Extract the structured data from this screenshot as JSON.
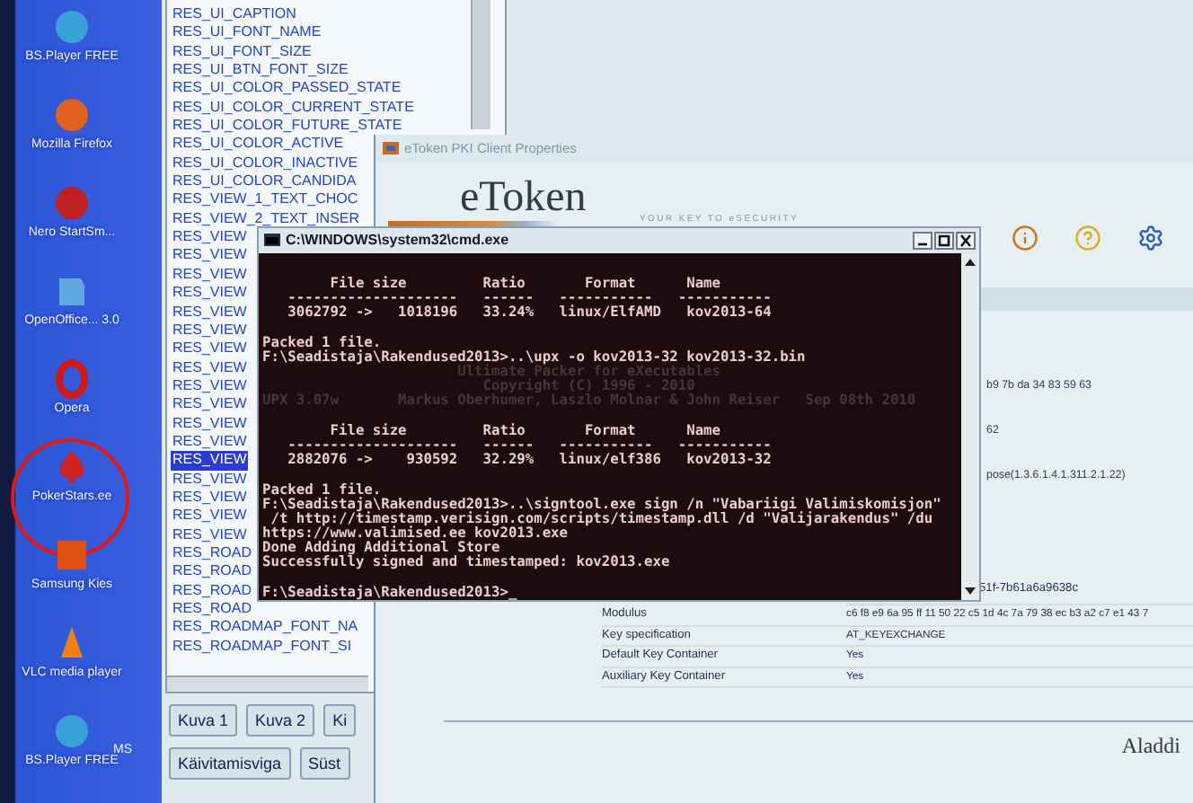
{
  "desktop_icons": [
    {
      "label": "BS.Player FREE",
      "kind": "player",
      "circled": false
    },
    {
      "label": "Mozilla Firefox",
      "kind": "firefox",
      "circled": false
    },
    {
      "label": "Nero StartSm...",
      "kind": "nero",
      "circled": false
    },
    {
      "label": "OpenOffice... 3.0",
      "kind": "office",
      "circled": false
    },
    {
      "label": "Opera",
      "kind": "opera",
      "circled": false
    },
    {
      "label": "PokerStars.ee",
      "kind": "poker",
      "circled": true
    },
    {
      "label": "Samsung Kies",
      "kind": "kies",
      "circled": false
    },
    {
      "label": "VLC media player",
      "kind": "vlc",
      "circled": false
    },
    {
      "label": "BS.Player FREE",
      "kind": "player",
      "circled": false
    }
  ],
  "desktop_partial_label": "MS",
  "resource_list": {
    "items": [
      {
        "text": "RES_UI_CAPTION",
        "selected": false
      },
      {
        "text": "RES_UI_FONT_NAME",
        "selected": false
      },
      {
        "text": "RES_UI_FONT_SIZE",
        "selected": false
      },
      {
        "text": "RES_UI_BTN_FONT_SIZE",
        "selected": false
      },
      {
        "text": "RES_UI_COLOR_PASSED_STATE",
        "selected": false
      },
      {
        "text": "RES_UI_COLOR_CURRENT_STATE",
        "selected": false
      },
      {
        "text": "RES_UI_COLOR_FUTURE_STATE",
        "selected": false
      },
      {
        "text": "RES_UI_COLOR_ACTIVE",
        "selected": false
      },
      {
        "text": "RES_UI_COLOR_INACTIVE",
        "selected": false
      },
      {
        "text": "RES_UI_COLOR_CANDIDA",
        "selected": false
      },
      {
        "text": "RES_VIEW_1_TEXT_CHOC",
        "selected": false
      },
      {
        "text": "RES_VIEW_2_TEXT_INSER",
        "selected": false
      },
      {
        "text": "RES_VIEW",
        "selected": false
      },
      {
        "text": "RES_VIEW",
        "selected": false
      },
      {
        "text": "RES_VIEW",
        "selected": false
      },
      {
        "text": "RES_VIEW",
        "selected": false
      },
      {
        "text": "RES_VIEW",
        "selected": false
      },
      {
        "text": "RES_VIEW",
        "selected": false
      },
      {
        "text": "RES_VIEW",
        "selected": false
      },
      {
        "text": "RES_VIEW",
        "selected": false
      },
      {
        "text": "RES_VIEW",
        "selected": false
      },
      {
        "text": "RES_VIEW",
        "selected": false
      },
      {
        "text": "RES_VIEW",
        "selected": false
      },
      {
        "text": "RES_VIEW",
        "selected": false
      },
      {
        "text": "RES_VIEW",
        "selected": true
      },
      {
        "text": "RES_VIEW",
        "selected": false
      },
      {
        "text": "RES_VIEW",
        "selected": false
      },
      {
        "text": "RES_VIEW",
        "selected": false
      },
      {
        "text": "RES_VIEW",
        "selected": false
      },
      {
        "text": "RES_ROAD",
        "selected": false
      },
      {
        "text": "RES_ROAD",
        "selected": false
      },
      {
        "text": "RES_ROAD",
        "selected": false
      },
      {
        "text": "RES_ROAD",
        "selected": false
      },
      {
        "text": "RES_ROADMAP_FONT_NA",
        "selected": false
      },
      {
        "text": "RES_ROADMAP_FONT_SI",
        "selected": false
      }
    ]
  },
  "buttons_row_1": [
    "Kuva 1",
    "Kuva 2",
    "Ki"
  ],
  "buttons_row_2": [
    "Käivitamisviga",
    "Süst"
  ],
  "etoken_window": {
    "title": "eToken PKI Client Properties",
    "logo": "eToken",
    "tagline": "YOUR KEY TO eSECURITY",
    "certificate_fragments": [
      "b9 7b da 34 83 59 63",
      "62",
      "pose(1.3.6.1.4.1.311.2.1.22)"
    ],
    "key_details": [
      {
        "kind": "fragment",
        "value": "51f-7b61a6a9638c"
      },
      {
        "kind": "pair",
        "label": "Modulus",
        "value": "c6 f8 e9 6a 95 ff 11 50 22 c5 1d 4c 7a 79 38 ec b3 a2 c7 e1 43 7"
      },
      {
        "kind": "pair",
        "label": "Key specification",
        "value": "AT_KEYEXCHANGE"
      },
      {
        "kind": "pair",
        "label": "Default Key Container",
        "value": "Yes"
      },
      {
        "kind": "pair",
        "label": "Auxiliary Key Container",
        "value": "Yes"
      }
    ],
    "brand": "Aladdi"
  },
  "console": {
    "title": "C:\\WINDOWS\\system32\\cmd.exe",
    "lines": [
      {
        "kind": "text",
        "text": "        File size         Ratio       Format      Name"
      },
      {
        "kind": "text",
        "text": "   --------------------   ------   -----------   -----------"
      },
      {
        "kind": "text",
        "text": "   3062792 ->   1018196   33.24%   linux/ElfAMD   kov2013-64"
      },
      {
        "kind": "blank"
      },
      {
        "kind": "text",
        "text": "Packed 1 file."
      },
      {
        "kind": "text",
        "text": "F:\\Seadistaja\\Rakendused2013>..\\upx -o kov2013-32 kov2013-32.bin"
      },
      {
        "kind": "dim",
        "text": "                       Ultimate Packer for eXecutables"
      },
      {
        "kind": "dim",
        "text": "                          Copyright (C) 1996 - 2010"
      },
      {
        "kind": "dim",
        "text": "UPX 3.07w       Markus Oberhumer, Laszlo Molnar & John Reiser   Sep 08th 2010"
      },
      {
        "kind": "blank"
      },
      {
        "kind": "text",
        "text": "        File size         Ratio       Format      Name"
      },
      {
        "kind": "text",
        "text": "   --------------------   ------   -----------   -----------"
      },
      {
        "kind": "text",
        "text": "   2882076 ->    930592   32.29%   linux/elf386   kov2013-32"
      },
      {
        "kind": "blank"
      },
      {
        "kind": "text",
        "text": "Packed 1 file."
      },
      {
        "kind": "text",
        "text": "F:\\Seadistaja\\Rakendused2013>..\\signtool.exe sign /n \"Vabariigi Valimiskomisjon\""
      },
      {
        "kind": "text",
        "text": " /t http://timestamp.verisign.com/scripts/timestamp.dll /d \"Valijarakendus\" /du"
      },
      {
        "kind": "text",
        "text": "https://www.valimised.ee kov2013.exe"
      },
      {
        "kind": "text",
        "text": "Done Adding Additional Store"
      },
      {
        "kind": "text",
        "text": "Successfully signed and timestamped: kov2013.exe"
      },
      {
        "kind": "blank"
      },
      {
        "kind": "text",
        "text": "F:\\Seadistaja\\Rakendused2013>_"
      }
    ]
  }
}
